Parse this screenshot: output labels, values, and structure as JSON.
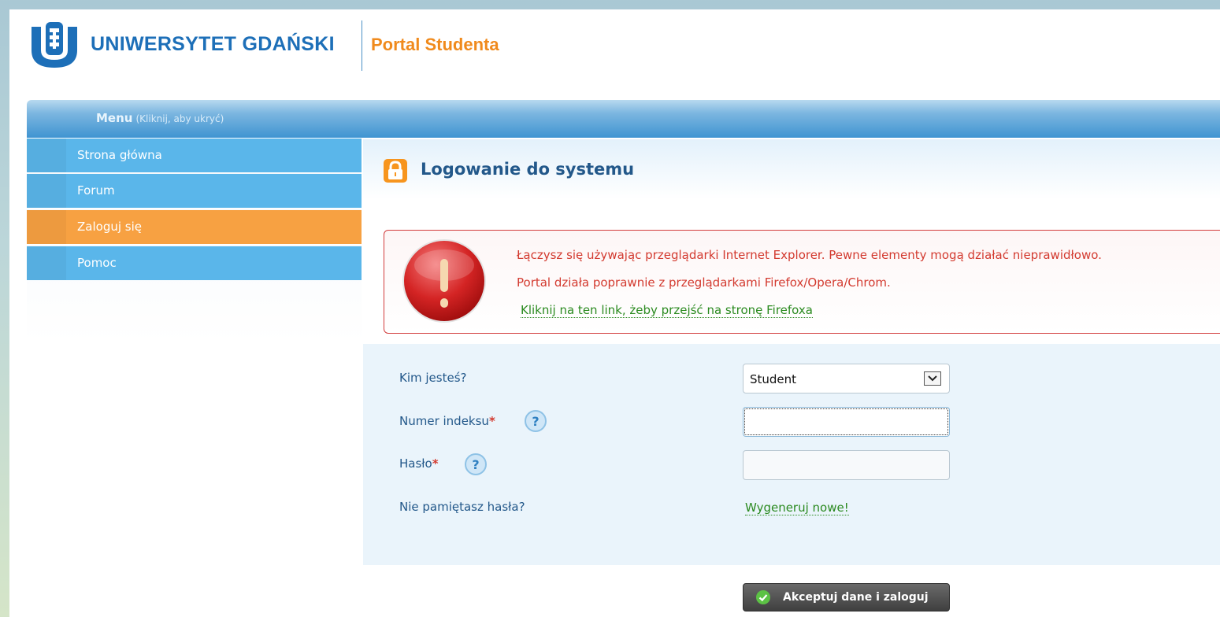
{
  "header": {
    "university": "UNIWERSYTET GDAŃSKI",
    "portal": "Portal Studenta"
  },
  "menubar": {
    "title": "Menu",
    "hint": "(Kliknij, aby ukryć)"
  },
  "sidebar": {
    "items": [
      {
        "label": "Strona główna"
      },
      {
        "label": "Forum"
      },
      {
        "label": "Zaloguj się",
        "active": true
      },
      {
        "label": "Pomoc"
      }
    ]
  },
  "content": {
    "title": "Logowanie do systemu"
  },
  "alert": {
    "line1": "Łączysz się używając przeglądarki Internet Explorer. Pewne elementy mogą działać nieprawidłowo.",
    "line2": "Portal działa poprawnie z przeglądarkami Firefox/Opera/Chrom.",
    "link": "Kliknij na ten link, żeby przejść na stronę Firefoxa"
  },
  "form": {
    "role_label": "Kim jesteś?",
    "role_value": "Student",
    "index_label": "Numer indeksu",
    "password_label": "Hasło",
    "required_mark": "*",
    "forgot_label": "Nie pamiętasz hasła?",
    "generate_link": "Wygeneruj nowe!",
    "submit_label": "Akceptuj dane i zaloguj"
  },
  "colors": {
    "brand_blue": "#1d6fb8",
    "portal_orange": "#f08a1c",
    "nav_blue": "#5ab6ea",
    "nav_active": "#f7a142",
    "alert_red": "#d33a2f",
    "link_green": "#2a8a1f"
  },
  "icons": [
    "university-logo-icon",
    "lock-icon",
    "alert-exclamation-icon",
    "help-icon",
    "checkmark-icon",
    "chevron-down-icon"
  ]
}
